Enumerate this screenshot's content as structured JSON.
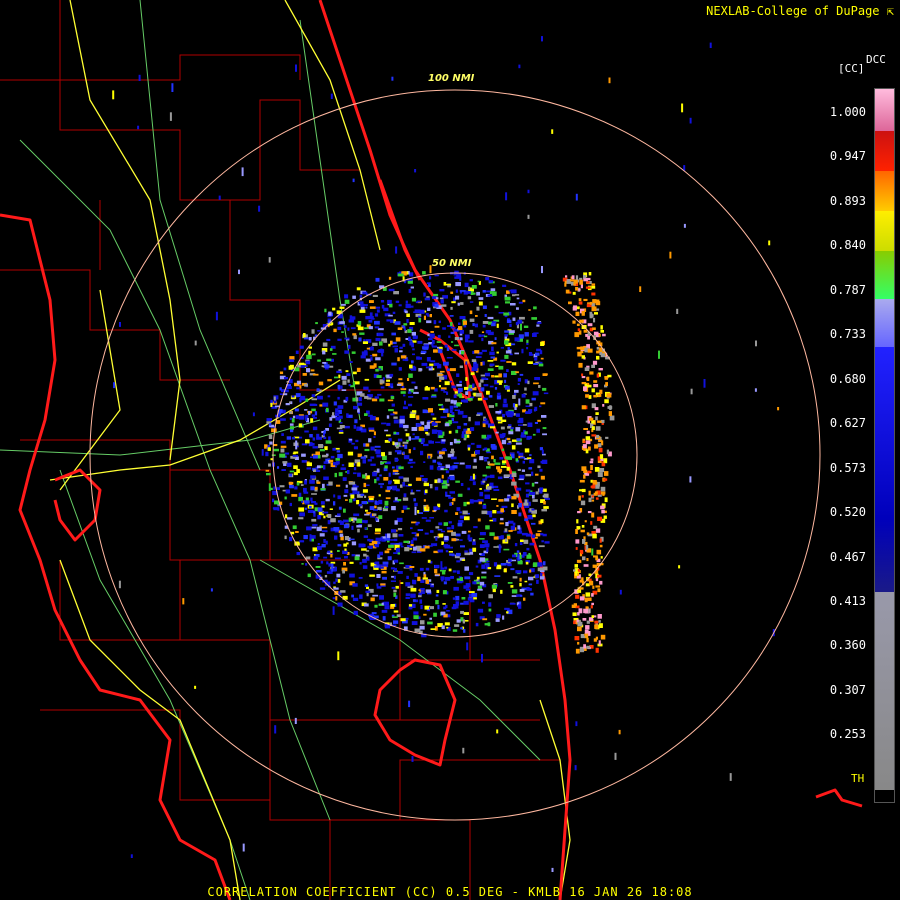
{
  "credit": "NEXLAB-College of DuPage",
  "product_code": "DCC",
  "unit": "[CC]",
  "footer": "CORRELATION COEFFICIENT (CC) 0.5 DEG - KMLB 16 JAN 26 18:08",
  "range_rings": [
    {
      "label": "100 NMI"
    },
    {
      "label": "50 NMI"
    }
  ],
  "colorbar": {
    "ticks": [
      "1.000",
      "0.947",
      "0.893",
      "0.840",
      "0.787",
      "0.733",
      "0.680",
      "0.627",
      "0.573",
      "0.520",
      "0.467",
      "0.413",
      "0.360",
      "0.307",
      "0.253"
    ],
    "th_label": "TH",
    "colors": {
      "pink": "#ff99cc",
      "red": "#ff0000",
      "orange": "#ff9900",
      "yellow": "#ffff00",
      "green": "#33cc33",
      "lavender": "#9999ff",
      "blue": "#1111dd",
      "gray": "#999999"
    }
  },
  "map_colors": {
    "coastline": "#ff1a1a",
    "county_lines": "#cc0000",
    "highways": "#ffff33",
    "roads": "#66cc66",
    "range_ring": "#ffb8a0"
  }
}
